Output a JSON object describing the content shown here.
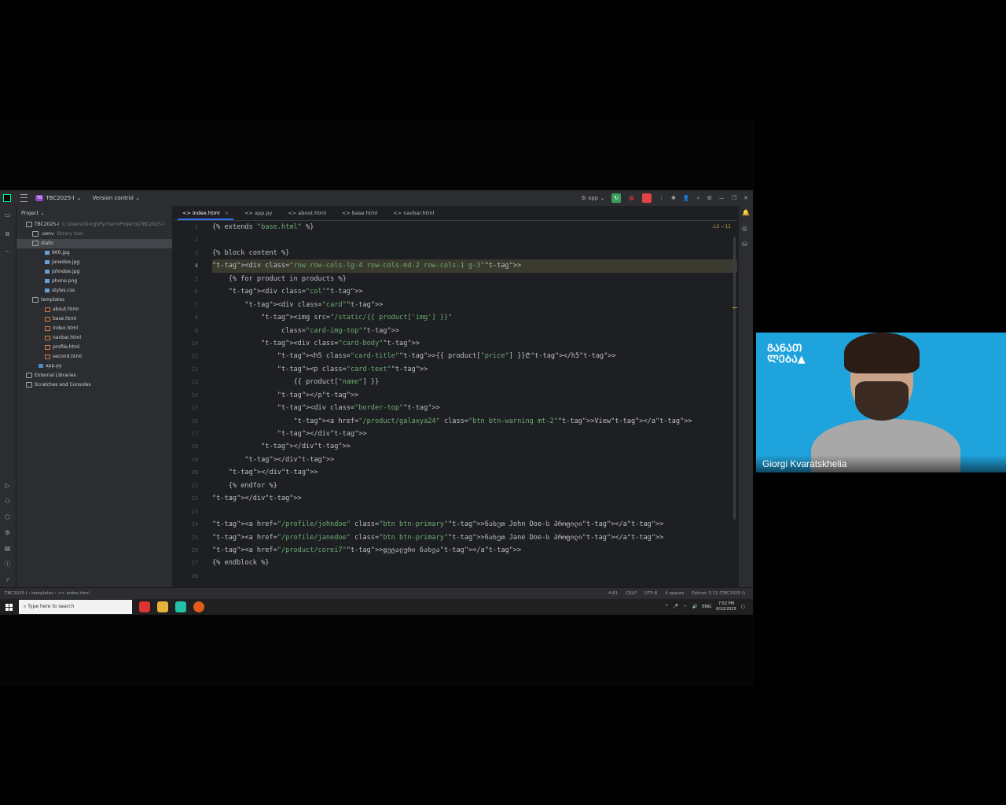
{
  "titlebar": {
    "project_badge": "TB",
    "project_name": "TBC2025-I",
    "version_control": "Version control",
    "run_config": "app"
  },
  "project_panel": {
    "header": "Project",
    "tree": [
      {
        "label": "TBC2025-I",
        "extra": "C:\\Users\\Giorgi\\PycharmProjects\\TBC2025-I",
        "indent": 1,
        "icon": "folder"
      },
      {
        "label": ".venv",
        "extra": "library root",
        "indent": 2,
        "icon": "folder"
      },
      {
        "label": "static",
        "extra": "",
        "indent": 2,
        "icon": "folder",
        "selected": true
      },
      {
        "label": "900.jpg",
        "extra": "",
        "indent": 4,
        "icon": "file"
      },
      {
        "label": "janedoe.jpg",
        "extra": "",
        "indent": 4,
        "icon": "file"
      },
      {
        "label": "johndoe.jpg",
        "extra": "",
        "indent": 4,
        "icon": "file"
      },
      {
        "label": "phone.png",
        "extra": "",
        "indent": 4,
        "icon": "file"
      },
      {
        "label": "styles.css",
        "extra": "",
        "indent": 4,
        "icon": "file"
      },
      {
        "label": "templates",
        "extra": "",
        "indent": 2,
        "icon": "folder"
      },
      {
        "label": "about.html",
        "extra": "",
        "indent": 4,
        "icon": "html"
      },
      {
        "label": "base.html",
        "extra": "",
        "indent": 4,
        "icon": "html"
      },
      {
        "label": "index.html",
        "extra": "",
        "indent": 4,
        "icon": "html"
      },
      {
        "label": "navbar.html",
        "extra": "",
        "indent": 4,
        "icon": "html"
      },
      {
        "label": "profile.html",
        "extra": "",
        "indent": 4,
        "icon": "html"
      },
      {
        "label": "second.html",
        "extra": "",
        "indent": 4,
        "icon": "html"
      },
      {
        "label": "app.py",
        "extra": "",
        "indent": 3,
        "icon": "py"
      },
      {
        "label": "External Libraries",
        "extra": "",
        "indent": 1,
        "icon": "folder"
      },
      {
        "label": "Scratches and Consoles",
        "extra": "",
        "indent": 1,
        "icon": "folder"
      }
    ]
  },
  "tabs": [
    {
      "label": "index.html",
      "active": true
    },
    {
      "label": "app.py",
      "active": false
    },
    {
      "label": "about.html",
      "active": false
    },
    {
      "label": "base.html",
      "active": false
    },
    {
      "label": "navbar.html",
      "active": false
    }
  ],
  "inspection": "⚠2 ✓11",
  "code_lines": [
    "{% extends \"base.html\" %}",
    "",
    "{% block content %}",
    "<div class=\"row row-cols-lg-4 row-cols-md-2 row-cols-1 g-3\">",
    "    {% for product in products %}",
    "    <div class=\"col\">",
    "        <div class=\"card\">",
    "            <img src=\"/static/{{ product['img'] }}\"",
    "                 class=\"card-img-top\">",
    "            <div class=\"card-body\">",
    "                <h5 class=\"card-title\">{{ product[\"price\"] }}₾</h5>",
    "                <p class=\"card-text\">",
    "                    {{ product[\"name\"] }}",
    "                </p>",
    "                <div class=\"border-top\">",
    "                    <a href=\"/product/galaxya24\" class=\"btn btn-warning mt-2\">View</a>",
    "                </div>",
    "            </div>",
    "        </div>",
    "    </div>",
    "    {% endfor %}",
    "</div>",
    "",
    "<a href=\"/profile/johndoe\" class=\"btn btn-primary\">ნახეთ John Doe-ს პროფილი</a>",
    "<a href=\"/profile/janedoe\" class=\"btn btn-primary\">ნახეთ Jane Doe-ს პროფილი</a>",
    "<a href=\"/product/corei7\">დეტალური ნახვა</a>",
    "{% endblock %}",
    ""
  ],
  "current_line": 4,
  "statusbar": {
    "breadcrumb": "TBC2025-I  ›  templates  ›  <> index.html",
    "position": "4:61",
    "line_sep": "CRLF",
    "encoding": "UTF-8",
    "indent": "4 spaces",
    "interpreter": "Python 3.12 (TBC2025-I)"
  },
  "taskbar": {
    "search_placeholder": "Type here to search",
    "lang": "ENG",
    "time": "7:52 PM",
    "date": "6/10/2025"
  },
  "webcam": {
    "logo_line1": "ᲒᲐᲜᲐᲗ",
    "logo_line2": "ᲚᲔᲑᲐ▲",
    "presenter_name": "Giorgi Kvaratskhelia"
  }
}
